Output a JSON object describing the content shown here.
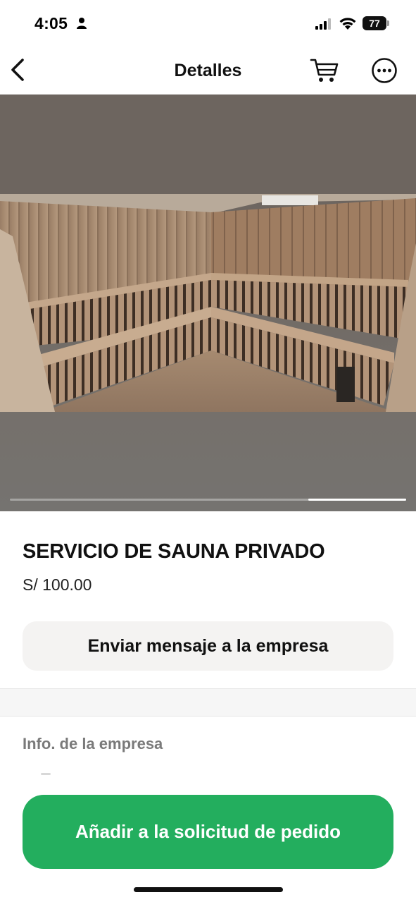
{
  "status_bar": {
    "time": "4:05",
    "battery": "77"
  },
  "nav": {
    "title": "Detalles"
  },
  "gallery": {
    "image_count_hint": "",
    "active_fraction_start": 0.75
  },
  "product": {
    "title": "SERVICIO DE SAUNA PRIVADO",
    "price": "S/ 100.00",
    "message_button": "Enviar mensaje a la empresa"
  },
  "company": {
    "section_label": "Info. de la empresa"
  },
  "footer": {
    "add_button": "Añadir a la solicitud de pedido"
  },
  "colors": {
    "accent_green": "#23ae5e",
    "button_gray": "#f4f3f2",
    "muted_text": "#7a7a7a"
  }
}
